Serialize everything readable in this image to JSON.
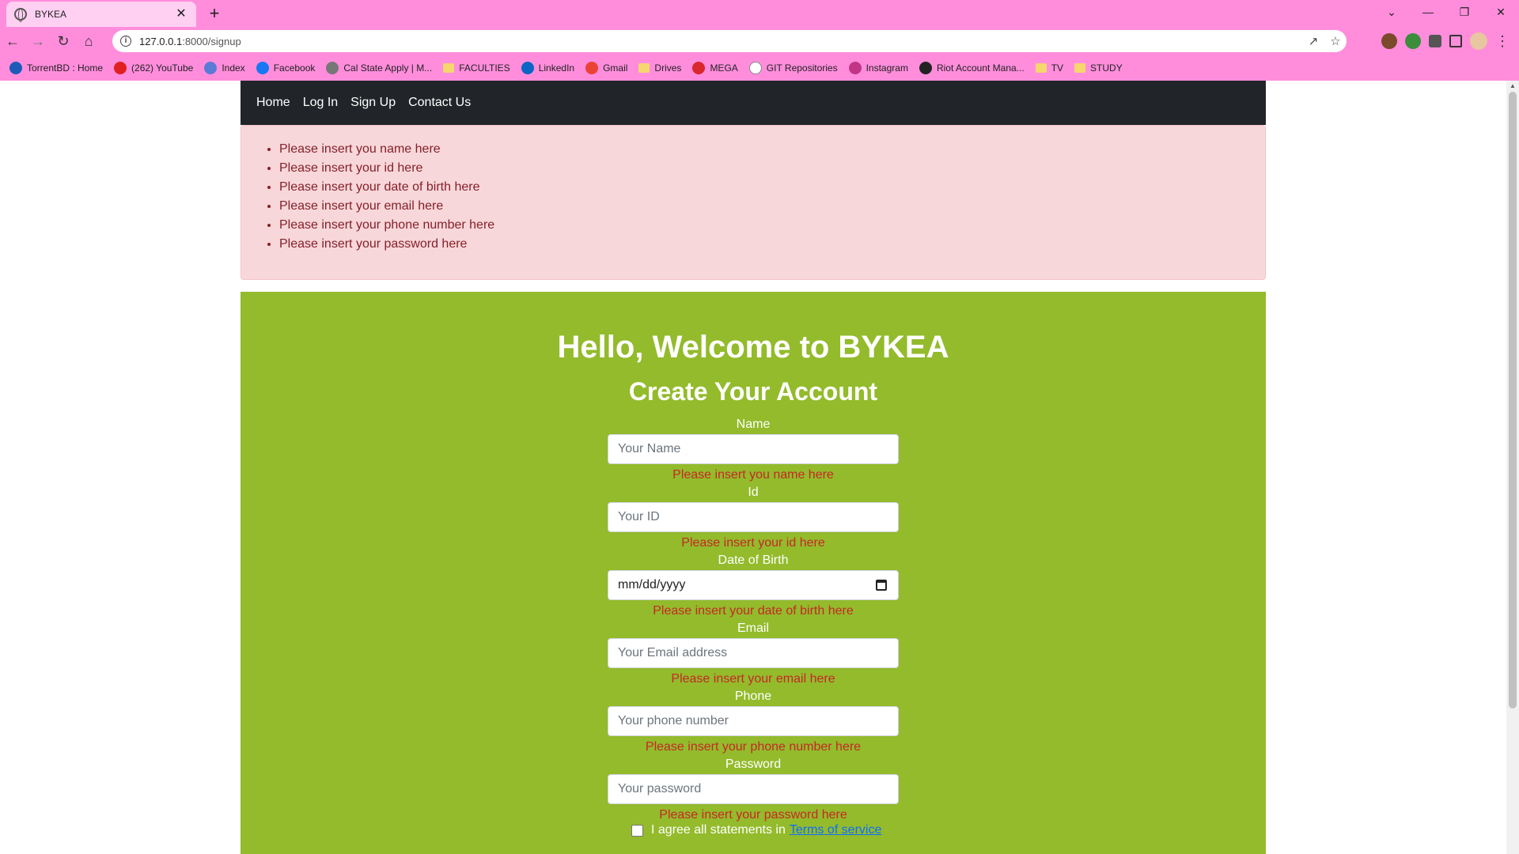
{
  "browser": {
    "tab_title": "BYKEA",
    "tab_close": "✕",
    "new_tab": "+",
    "window_controls": {
      "collapse": "⌄",
      "minimize": "—",
      "restore": "❐",
      "close": "✕"
    },
    "url_host": "127.0.0.1",
    "url_path": ":8000/signup",
    "bookmarks": [
      {
        "label": "TorrentBD : Home",
        "icon": "torrentbd-icon",
        "color": "#1e5bb8"
      },
      {
        "label": "(262) YouTube",
        "icon": "youtube-icon",
        "color": "#e02020"
      },
      {
        "label": "Index",
        "icon": "globe-icon",
        "color": "#5a7bd6"
      },
      {
        "label": "Facebook",
        "icon": "facebook-icon",
        "color": "#1877f2"
      },
      {
        "label": "Cal State Apply | M...",
        "icon": "globe-icon",
        "color": "#777777"
      },
      {
        "label": "FACULTIES",
        "icon": "folder-icon",
        "color": "#f5d76e"
      },
      {
        "label": "LinkedIn",
        "icon": "linkedin-icon",
        "color": "#0a66c2"
      },
      {
        "label": "Gmail",
        "icon": "gmail-icon",
        "color": "#ea4335"
      },
      {
        "label": "Drives",
        "icon": "folder-icon",
        "color": "#f5d76e"
      },
      {
        "label": "MEGA",
        "icon": "mega-icon",
        "color": "#d9272e"
      },
      {
        "label": "GIT Repositories",
        "icon": "globe-icon",
        "color": "#ffffff"
      },
      {
        "label": "Instagram",
        "icon": "instagram-icon",
        "color": "#c13584"
      },
      {
        "label": "Riot Account Mana...",
        "icon": "riot-icon",
        "color": "#222222"
      },
      {
        "label": "TV",
        "icon": "folder-icon",
        "color": "#f5d76e"
      },
      {
        "label": "STUDY",
        "icon": "folder-icon",
        "color": "#f5d76e"
      }
    ]
  },
  "nav": {
    "home": "Home",
    "login": "Log In",
    "signup": "Sign Up",
    "contact": "Contact Us"
  },
  "alert": {
    "errors": [
      "Please insert you name here",
      "Please insert your id here",
      "Please insert your date of birth here",
      "Please insert your email here",
      "Please insert your phone number here",
      "Please insert your password here"
    ]
  },
  "form": {
    "heading": "Hello, Welcome to BYKEA",
    "subheading": "Create Your Account",
    "fields": [
      {
        "label": "Name",
        "placeholder": "Your Name",
        "error": "Please insert you name here"
      },
      {
        "label": "Id",
        "placeholder": "Your ID",
        "error": "Please insert your id here"
      },
      {
        "label": "Date of Birth",
        "placeholder": "mm/dd/yyyy",
        "error": "Please insert your date of birth here"
      },
      {
        "label": "Email",
        "placeholder": "Your Email address",
        "error": "Please insert your email here"
      },
      {
        "label": "Phone",
        "placeholder": "Your phone number",
        "error": "Please insert your phone number here"
      },
      {
        "label": "Password",
        "placeholder": "Your password",
        "error": "Please insert your password here"
      }
    ],
    "agree_text": "I agree all statements in",
    "terms_link": "Terms of service"
  },
  "colors": {
    "chrome": "#ff8ddc",
    "navbar": "#212529",
    "alert_bg": "#f8d7da",
    "alert_text": "#842029",
    "form_bg": "#93bb2b",
    "error_text": "#c62828",
    "link": "#0d6efd"
  }
}
